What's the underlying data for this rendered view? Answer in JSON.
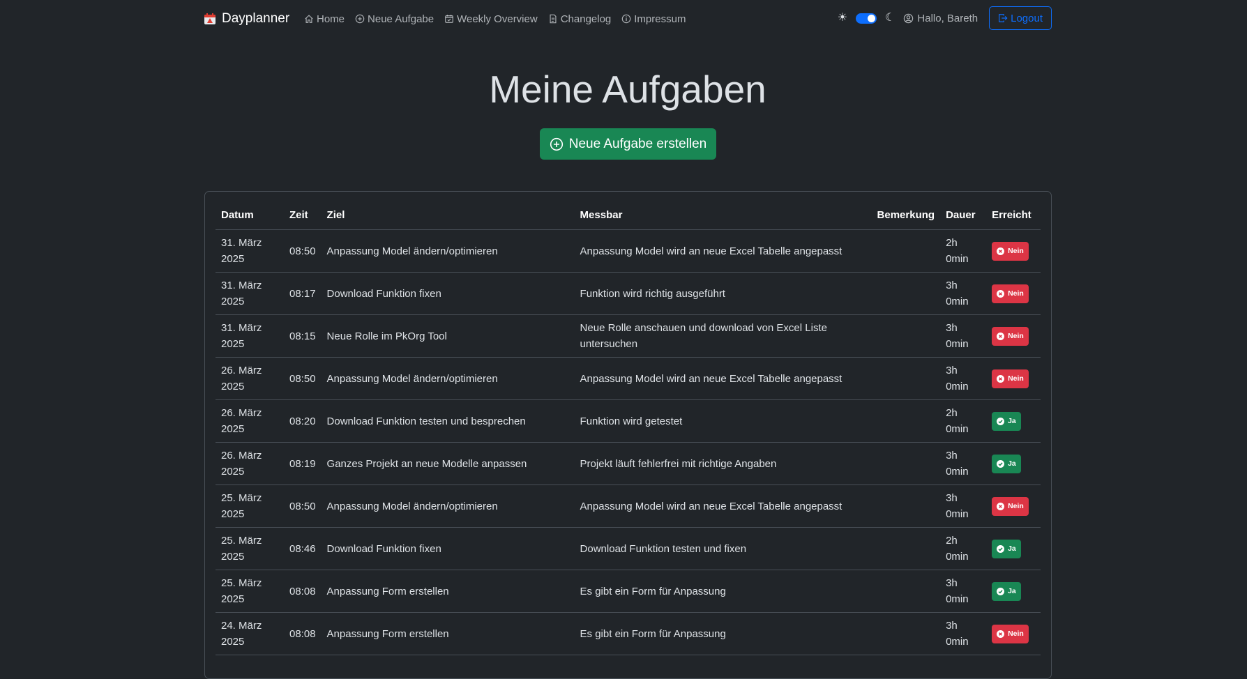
{
  "navbar": {
    "brand": "Dayplanner",
    "links": [
      {
        "label": "Home",
        "icon": "home-icon"
      },
      {
        "label": "Neue Aufgabe",
        "icon": "plus-circle-icon"
      },
      {
        "label": "Weekly Overview",
        "icon": "calendar-check-icon"
      },
      {
        "label": "Changelog",
        "icon": "document-icon"
      },
      {
        "label": "Impressum",
        "icon": "info-circle-icon"
      }
    ],
    "theme_light_icon": "☀",
    "theme_dark_icon": "☾",
    "greeting": "Hallo, Bareth",
    "logout": "Logout"
  },
  "main": {
    "title": "Meine Aufgaben",
    "create_button": "Neue Aufgabe erstellen"
  },
  "table": {
    "headers": [
      "Datum",
      "Zeit",
      "Ziel",
      "Messbar",
      "Bemerkung",
      "Dauer",
      "Erreicht"
    ],
    "rows": [
      {
        "date": "31. März 2025",
        "time": "08:50",
        "ziel": "Anpassung Model ändern/optimieren",
        "messbar": "Anpassung Model wird an neue Excel Tabelle angepasst",
        "bemerkung": "",
        "dauer": "2h 0min",
        "erreicht": "Nein"
      },
      {
        "date": "31. März 2025",
        "time": "08:17",
        "ziel": "Download Funktion fixen",
        "messbar": "Funktion wird richtig ausgeführt",
        "bemerkung": "",
        "dauer": "3h 0min",
        "erreicht": "Nein"
      },
      {
        "date": "31. März 2025",
        "time": "08:15",
        "ziel": "Neue Rolle im PkOrg Tool",
        "messbar": "Neue Rolle anschauen und download von Excel Liste untersuchen",
        "bemerkung": "",
        "dauer": "3h 0min",
        "erreicht": "Nein"
      },
      {
        "date": "26. März 2025",
        "time": "08:50",
        "ziel": "Anpassung Model ändern/optimieren",
        "messbar": "Anpassung Model wird an neue Excel Tabelle angepasst",
        "bemerkung": "",
        "dauer": "3h 0min",
        "erreicht": "Nein"
      },
      {
        "date": "26. März 2025",
        "time": "08:20",
        "ziel": "Download Funktion testen und besprechen",
        "messbar": "Funktion wird getestet",
        "bemerkung": "",
        "dauer": "2h 0min",
        "erreicht": "Ja"
      },
      {
        "date": "26. März 2025",
        "time": "08:19",
        "ziel": "Ganzes Projekt an neue Modelle anpassen",
        "messbar": "Projekt läuft fehlerfrei mit richtige Angaben",
        "bemerkung": "",
        "dauer": "3h 0min",
        "erreicht": "Ja"
      },
      {
        "date": "25. März 2025",
        "time": "08:50",
        "ziel": "Anpassung Model ändern/optimieren",
        "messbar": "Anpassung Model wird an neue Excel Tabelle angepasst",
        "bemerkung": "",
        "dauer": "3h 0min",
        "erreicht": "Nein"
      },
      {
        "date": "25. März 2025",
        "time": "08:46",
        "ziel": "Download Funktion fixen",
        "messbar": "Download Funktion testen und fixen",
        "bemerkung": "",
        "dauer": "2h 0min",
        "erreicht": "Ja"
      },
      {
        "date": "25. März 2025",
        "time": "08:08",
        "ziel": "Anpassung Form erstellen",
        "messbar": "Es gibt ein Form für Anpassung",
        "bemerkung": "",
        "dauer": "3h 0min",
        "erreicht": "Ja"
      },
      {
        "date": "24. März 2025",
        "time": "08:08",
        "ziel": "Anpassung Form erstellen",
        "messbar": "Es gibt ein Form für Anpassung",
        "bemerkung": "",
        "dauer": "3h 0min",
        "erreicht": "Nein"
      }
    ]
  },
  "colors": {
    "background": "#212529",
    "primary": "#0d6efd",
    "success": "#198754",
    "danger": "#dc3545"
  }
}
